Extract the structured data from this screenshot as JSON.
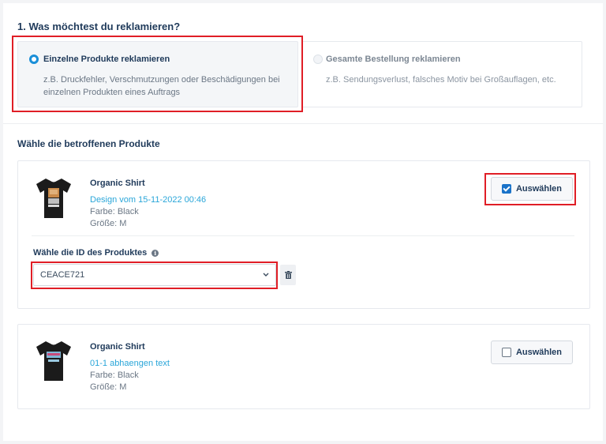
{
  "step1": {
    "title": "1. Was möchtest du reklamieren?",
    "options": [
      {
        "title": "Einzelne Produkte reklamieren",
        "desc_line1": "z.B. Druckfehler, Verschmutzungen oder Beschädigungen bei",
        "desc_line2": "einzelnen Produkten eines Auftrags",
        "selected": true
      },
      {
        "title": "Gesamte Bestellung reklamieren",
        "desc_line1": "z.B. Sendungsverlust, falsches Motiv bei Großauflagen, etc.",
        "selected": false
      }
    ]
  },
  "products_section": {
    "title": "Wähle die betroffenen Produkte",
    "products": [
      {
        "name": "Organic Shirt",
        "design": "Design vom 15-11-2022 00:46",
        "color": "Farbe: Black",
        "size": "Größe: M",
        "select_label": "Auswählen",
        "selected": true,
        "id_label": "Wähle die ID des Produktes",
        "id_value": "CEACE721"
      },
      {
        "name": "Organic Shirt",
        "design": "01-1 abhaengen text",
        "color": "Farbe: Black",
        "size": "Größe: M",
        "select_label": "Auswählen",
        "selected": false
      }
    ]
  },
  "colors": {
    "accent": "#1a8fd8",
    "link": "#2aa6d9",
    "highlight": "#e01e26"
  }
}
